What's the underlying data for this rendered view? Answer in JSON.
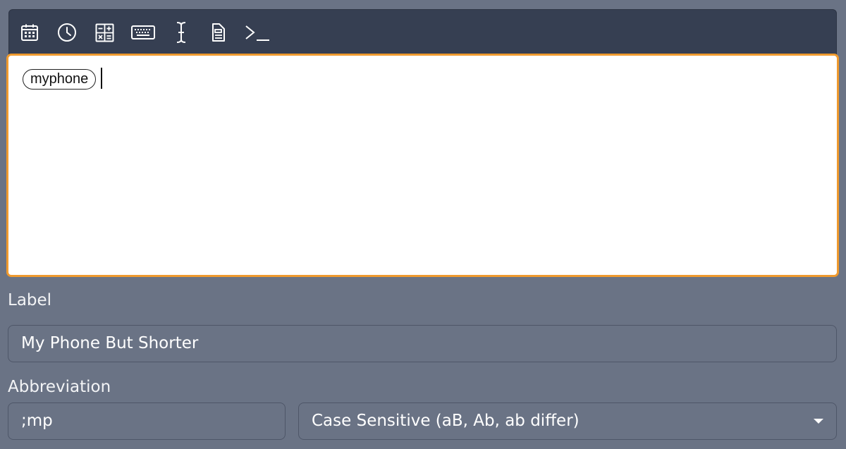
{
  "toolbar": {
    "buttons": [
      {
        "icon": "calendar-icon"
      },
      {
        "icon": "clock-icon"
      },
      {
        "icon": "calculator-icon"
      },
      {
        "icon": "keyboard-icon"
      },
      {
        "icon": "text-cursor-icon"
      },
      {
        "icon": "clipboard-icon"
      },
      {
        "icon": "terminal-icon"
      }
    ]
  },
  "editor": {
    "chip_text": "myphone"
  },
  "label_field": {
    "label": "Label",
    "value": "My Phone But Shorter"
  },
  "abbreviation_field": {
    "label": "Abbreviation",
    "value": ";mp"
  },
  "case_select": {
    "selected": "Case Sensitive (aB, Ab, ab differ)"
  },
  "colors": {
    "background": "#6a7385",
    "toolbar": "#363f52",
    "focus_border": "#ef9a2e",
    "editor_bg": "#ffffff"
  }
}
